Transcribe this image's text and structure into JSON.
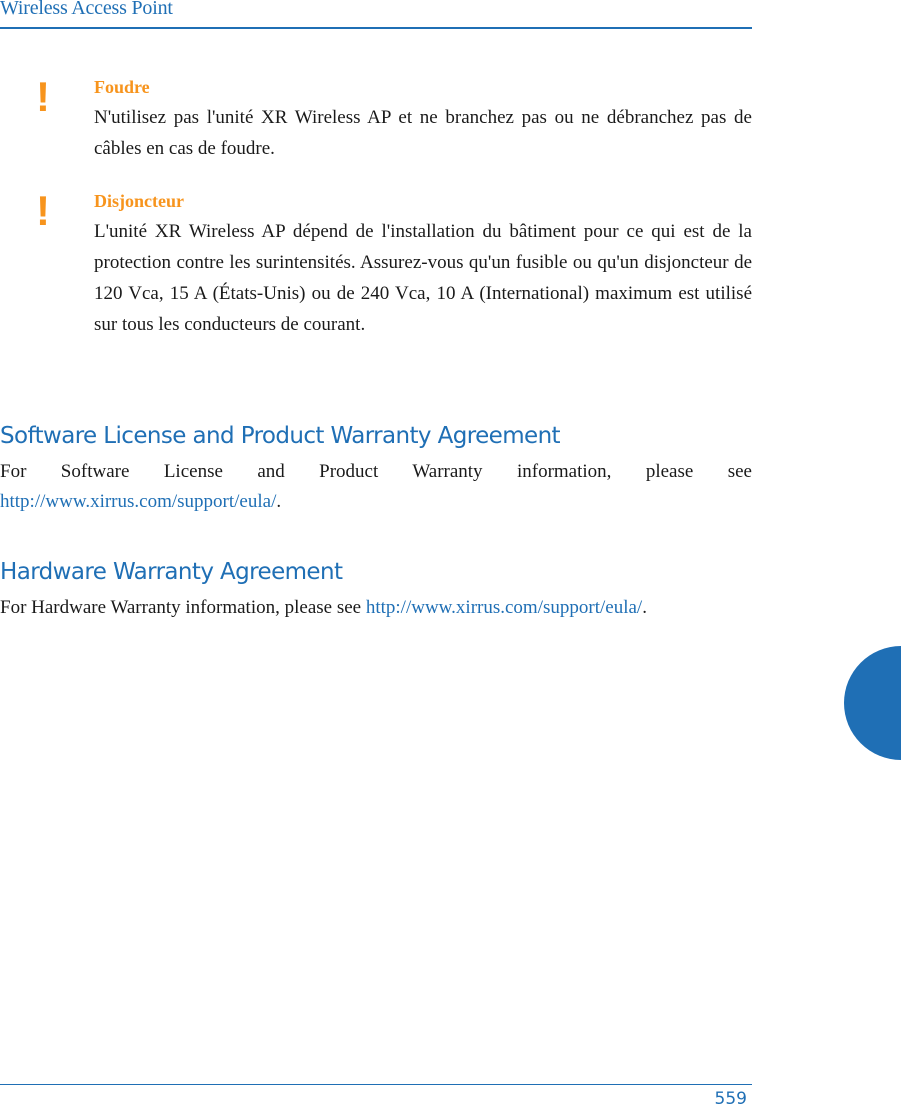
{
  "header": {
    "title": "Wireless Access Point"
  },
  "warnings": [
    {
      "icon": "exclamation-icon",
      "title": "Foudre",
      "body": "N'utilisez pas l'unité XR Wireless AP et ne branchez pas ou ne débranchez pas de câbles en cas de foudre."
    },
    {
      "icon": "exclamation-icon",
      "title": "Disjoncteur",
      "body": "L'unité XR Wireless AP dépend de l'installation du bâtiment pour ce qui est de la protection contre les surintensités. Assurez-vous qu'un fusible ou qu'un disjoncteur de 120 Vca, 15 A (États-Unis) ou de 240 Vca, 10 A (International) maximum est utilisé sur tous les conducteurs de courant."
    }
  ],
  "sections": [
    {
      "heading": "Software License and Product Warranty Agreement",
      "text": "For Software License and Product Warranty information, please see ",
      "link": "http://www.xirrus.com/support/eula/",
      "suffix": "."
    },
    {
      "heading": "Hardware Warranty Agreement",
      "text": "For Hardware Warranty information, please see ",
      "link": "http://www.xirrus.com/support/eula/",
      "suffix": "."
    }
  ],
  "footer": {
    "page_number": "559"
  },
  "colors": {
    "accent_blue": "#1f6fb5",
    "warning_orange": "#f7941d"
  }
}
